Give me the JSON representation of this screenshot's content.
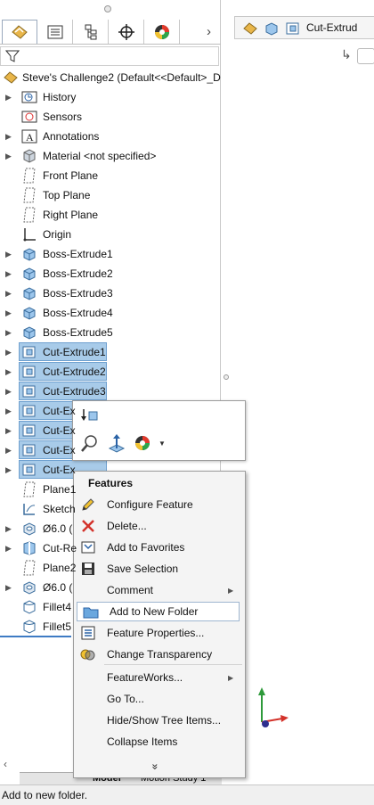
{
  "feature_manager": {
    "root_label": "Steve's Challenge2  (Default<<Default>_D",
    "items": [
      {
        "label": "History",
        "icon": "history-icon",
        "expand": true,
        "selected": false
      },
      {
        "label": "Sensors",
        "icon": "sensors-icon",
        "expand": false,
        "selected": false
      },
      {
        "label": "Annotations",
        "icon": "annotations-icon",
        "expand": true,
        "selected": false
      },
      {
        "label": "Material <not specified>",
        "icon": "material-icon",
        "expand": true,
        "selected": false
      },
      {
        "label": "Front Plane",
        "icon": "plane-icon",
        "expand": false,
        "selected": false
      },
      {
        "label": "Top Plane",
        "icon": "plane-icon",
        "expand": false,
        "selected": false
      },
      {
        "label": "Right Plane",
        "icon": "plane-icon",
        "expand": false,
        "selected": false
      },
      {
        "label": "Origin",
        "icon": "origin-icon",
        "expand": false,
        "selected": false
      },
      {
        "label": "Boss-Extrude1",
        "icon": "boss-extrude-icon",
        "expand": true,
        "selected": false
      },
      {
        "label": "Boss-Extrude2",
        "icon": "boss-extrude-icon",
        "expand": true,
        "selected": false
      },
      {
        "label": "Boss-Extrude3",
        "icon": "boss-extrude-icon",
        "expand": true,
        "selected": false
      },
      {
        "label": "Boss-Extrude4",
        "icon": "boss-extrude-icon",
        "expand": true,
        "selected": false
      },
      {
        "label": "Boss-Extrude5",
        "icon": "boss-extrude-icon",
        "expand": true,
        "selected": false
      },
      {
        "label": "Cut-Extrude1",
        "icon": "cut-extrude-icon",
        "expand": true,
        "selected": true
      },
      {
        "label": "Cut-Extrude2",
        "icon": "cut-extrude-icon",
        "expand": true,
        "selected": true
      },
      {
        "label": "Cut-Extrude3",
        "icon": "cut-extrude-icon",
        "expand": true,
        "selected": true
      },
      {
        "label": "Cut-Ex",
        "icon": "cut-extrude-icon",
        "expand": true,
        "selected": true
      },
      {
        "label": "Cut-Ex",
        "icon": "cut-extrude-icon",
        "expand": true,
        "selected": true
      },
      {
        "label": "Cut-Ex",
        "icon": "cut-extrude-icon",
        "expand": true,
        "selected": true
      },
      {
        "label": "Cut-Ex",
        "icon": "cut-extrude-icon",
        "expand": true,
        "selected": true
      },
      {
        "label": "Plane1",
        "icon": "plane-icon",
        "expand": false,
        "selected": false
      },
      {
        "label": "Sketch",
        "icon": "sketch-icon",
        "expand": false,
        "selected": false
      },
      {
        "label": "Ø6.0 (",
        "icon": "hole-icon",
        "expand": true,
        "selected": false
      },
      {
        "label": "Cut-Re",
        "icon": "cut-revolve-icon",
        "expand": true,
        "selected": false
      },
      {
        "label": "Plane2",
        "icon": "plane-icon",
        "expand": false,
        "selected": false
      },
      {
        "label": "Ø6.0 (",
        "icon": "hole-icon",
        "expand": true,
        "selected": false
      },
      {
        "label": "Fillet4",
        "icon": "fillet-icon",
        "expand": false,
        "selected": false
      },
      {
        "label": "Fillet5",
        "icon": "fillet-icon",
        "expand": false,
        "selected": false
      }
    ]
  },
  "breadcrumb": {
    "label": "Cut-Extrud"
  },
  "context_menu": {
    "title": "Features",
    "items": [
      {
        "label": "Configure Feature",
        "icon": "pencil-icon",
        "submenu": false,
        "highlighted": false
      },
      {
        "label": "Delete...",
        "icon": "delete-x-icon",
        "submenu": false,
        "highlighted": false
      },
      {
        "label": "Add to Favorites",
        "icon": "favorites-icon",
        "submenu": false,
        "highlighted": false
      },
      {
        "label": "Save Selection",
        "icon": "save-selection-icon",
        "submenu": false,
        "highlighted": false
      },
      {
        "label": "Comment",
        "icon": "",
        "submenu": true,
        "highlighted": false
      },
      {
        "label": "Add to New Folder",
        "icon": "folder-icon",
        "submenu": false,
        "highlighted": true
      },
      {
        "label": "Feature Properties...",
        "icon": "properties-icon",
        "submenu": false,
        "highlighted": false
      },
      {
        "label": "Change Transparency",
        "icon": "transparency-icon",
        "submenu": false,
        "highlighted": false
      },
      {
        "label": "FeatureWorks...",
        "icon": "",
        "submenu": true,
        "highlighted": false
      },
      {
        "label": "Go To...",
        "icon": "",
        "submenu": false,
        "highlighted": false
      },
      {
        "label": "Hide/Show Tree Items...",
        "icon": "",
        "submenu": false,
        "highlighted": false
      },
      {
        "label": "Collapse Items",
        "icon": "",
        "submenu": false,
        "highlighted": false
      }
    ],
    "more": "»"
  },
  "bottom_tabs": {
    "model": "Model",
    "motion": "Motion Study 1"
  },
  "status": {
    "text": "Add to new folder."
  }
}
